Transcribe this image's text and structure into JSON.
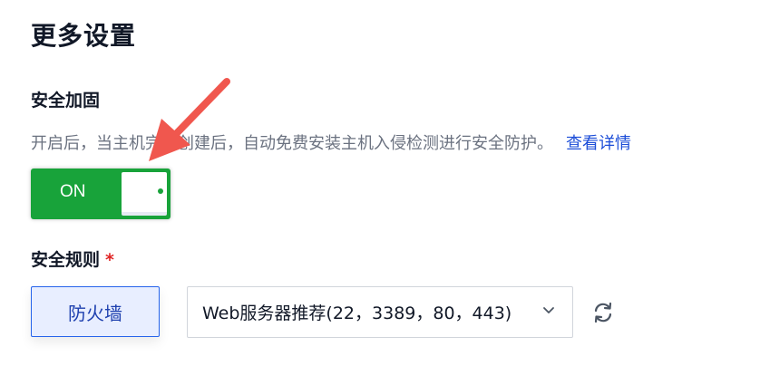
{
  "section": {
    "title": "更多设置"
  },
  "hardening": {
    "label": "安全加固",
    "description": "开启后，当主机完成创建后，自动免费安装主机入侵检测进行安全防护。",
    "link": "查看详情",
    "toggle_label": "ON"
  },
  "rules": {
    "label": "安全规则",
    "required_mark": "*",
    "firewall_button": "防火墙",
    "selected": "Web服务器推荐(22，3389，80，443)"
  },
  "colors": {
    "toggle_on": "#18a33a",
    "accent": "#2563eb",
    "annotation_arrow": "#f0574e"
  },
  "icons": [
    "chevron-down-icon",
    "refresh-icon",
    "annotation-arrow"
  ]
}
